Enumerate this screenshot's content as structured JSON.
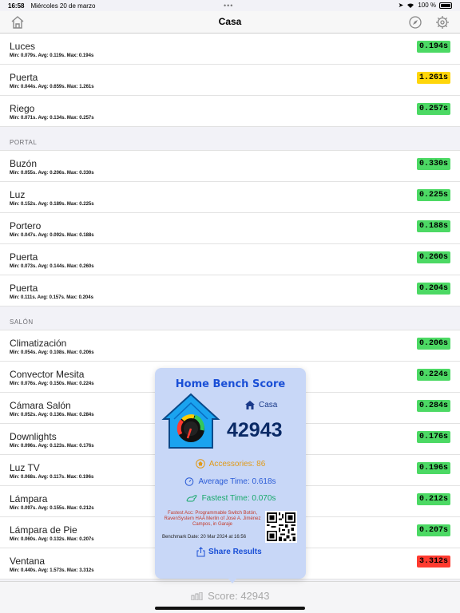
{
  "status": {
    "time": "16:58",
    "date": "Miércoles 20 de marzo",
    "battery": "100 %"
  },
  "nav": {
    "title": "Casa"
  },
  "sections": [
    {
      "header": "",
      "rows": [
        {
          "name": "Luces",
          "stats": "Min: 0.079s. Avg: 0.119s. Max: 0.194s",
          "badge": "0.194s",
          "status": "green"
        },
        {
          "name": "Puerta",
          "stats": "Min: 0.044s. Avg: 0.659s. Max: 1.261s",
          "badge": "1.261s",
          "status": "yellow"
        },
        {
          "name": "Riego",
          "stats": "Min: 0.071s. Avg: 0.134s. Max: 0.257s",
          "badge": "0.257s",
          "status": "green"
        }
      ]
    },
    {
      "header": "PORTAL",
      "rows": [
        {
          "name": "Buzón",
          "stats": "Min: 0.055s. Avg: 0.206s. Max: 0.330s",
          "badge": "0.330s",
          "status": "green"
        },
        {
          "name": "Luz",
          "stats": "Min: 0.152s. Avg: 0.189s. Max: 0.225s",
          "badge": "0.225s",
          "status": "green"
        },
        {
          "name": "Portero",
          "stats": "Min: 0.047s. Avg: 0.092s. Max: 0.188s",
          "badge": "0.188s",
          "status": "green"
        },
        {
          "name": "Puerta",
          "stats": "Min: 0.073s. Avg: 0.144s. Max: 0.260s",
          "badge": "0.260s",
          "status": "green"
        },
        {
          "name": "Puerta",
          "stats": "Min: 0.111s. Avg: 0.157s. Max: 0.204s",
          "badge": "0.204s",
          "status": "green"
        }
      ]
    },
    {
      "header": "SALÓN",
      "rows": [
        {
          "name": "Climatización",
          "stats": "Min: 0.054s. Avg: 0.108s. Max: 0.206s",
          "badge": "0.206s",
          "status": "green"
        },
        {
          "name": "Convector Mesita",
          "stats": "Min: 0.076s. Avg: 0.150s. Max: 0.224s",
          "badge": "0.224s",
          "status": "green"
        },
        {
          "name": "Cámara Salón",
          "stats": "Min: 0.052s. Avg: 0.136s. Max: 0.284s",
          "badge": "0.284s",
          "status": "green"
        },
        {
          "name": "Downlights",
          "stats": "Min: 0.096s. Avg: 0.123s. Max: 0.176s",
          "badge": "0.176s",
          "status": "green"
        },
        {
          "name": "Luz TV",
          "stats": "Min: 0.068s. Avg: 0.117s. Max: 0.196s",
          "badge": "0.196s",
          "status": "green"
        },
        {
          "name": "Lámpara",
          "stats": "Min: 0.097s. Avg: 0.155s. Max: 0.212s",
          "badge": "0.212s",
          "status": "green"
        },
        {
          "name": "Lámpara de Pie",
          "stats": "Min: 0.060s. Avg: 0.132s. Max: 0.207s",
          "badge": "0.207s",
          "status": "green"
        },
        {
          "name": "Ventana",
          "stats": "Min: 0.440s. Avg: 1.573s. Max: 3.312s",
          "badge": "3.312s",
          "status": "red"
        }
      ]
    }
  ],
  "popup": {
    "title": "Home Bench Score",
    "home_name": "Casa",
    "score": "42943",
    "accessories": "Accessories: 86",
    "average_time": "Average Time: 0.618s",
    "fastest_time": "Fastest Time: 0.070s",
    "fastest_acc": "Fastest Acc: Programmable Switch Botón, RavenSystem HAA Merlin of José A. Jiménez Campos, in Garaje",
    "benchmark_date": "Benchmark Date: 20 Mar 2024 at 16:56",
    "share_label": "Share Results"
  },
  "bottom": {
    "score_label": "Score: 42943"
  },
  "colors": {
    "green": "#4cd964",
    "yellow": "#ffd60a",
    "red": "#ff3b30",
    "accent": "#1a4fd6"
  }
}
